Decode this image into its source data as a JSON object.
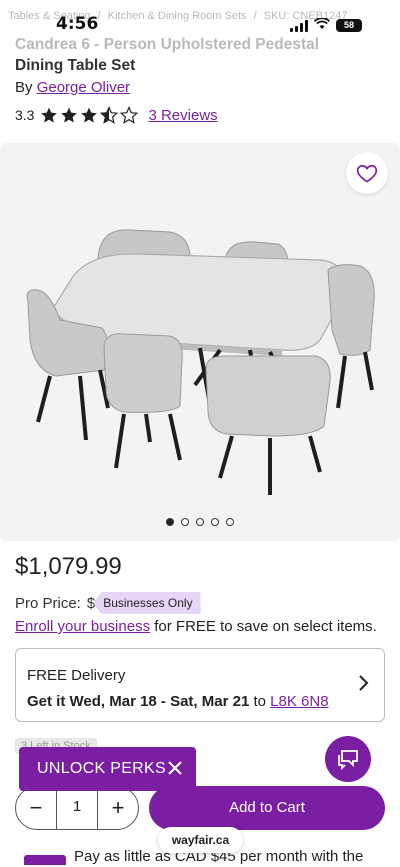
{
  "status_bar": {
    "time": "4:56",
    "battery": "58",
    "breadcrumb": [
      "Tables & Seating",
      "/",
      "Kitchen & Dining Room Sets",
      "/",
      "SKU: CNEB1247"
    ]
  },
  "product": {
    "title_line1": "Candrea 6 - Person Upholstered Pedestal",
    "title_line2": "Dining Table Set",
    "by_prefix": "By",
    "brand": "George Oliver",
    "rating": "3.3",
    "rating_value": 3.3,
    "rating_max": 5,
    "reviews_label": "3 Reviews"
  },
  "gallery": {
    "image_count": 5,
    "active_index": 0,
    "favorite_icon": "heart-outline-icon"
  },
  "pricing": {
    "price": "$1,079.99",
    "pro_label": "Pro Price:",
    "pro_hidden": "$",
    "pro_badge": "Businesses Only",
    "enroll_link": "Enroll your business",
    "enroll_rest": " for FREE to save on select items."
  },
  "delivery": {
    "title": "FREE Delivery",
    "dates": "Get it Wed, Mar 18 - Sat, Mar 21",
    "to": " to ",
    "postal": "L8K 6N8"
  },
  "stock": {
    "label": "3 Left in Stock"
  },
  "perks": {
    "label": "UNLOCK PERKS"
  },
  "purchase": {
    "quantity": "1",
    "minus": "−",
    "plus": "+",
    "add_to_cart": "Add to Cart"
  },
  "browser": {
    "url": "wayfair.ca"
  },
  "financing": {
    "text": "Pay as little as CAD $45 per month with the"
  },
  "colors": {
    "accent": "#7b1fa2",
    "badge_bg": "#e7d5f5",
    "gallery_bg": "#f3f3f3"
  }
}
